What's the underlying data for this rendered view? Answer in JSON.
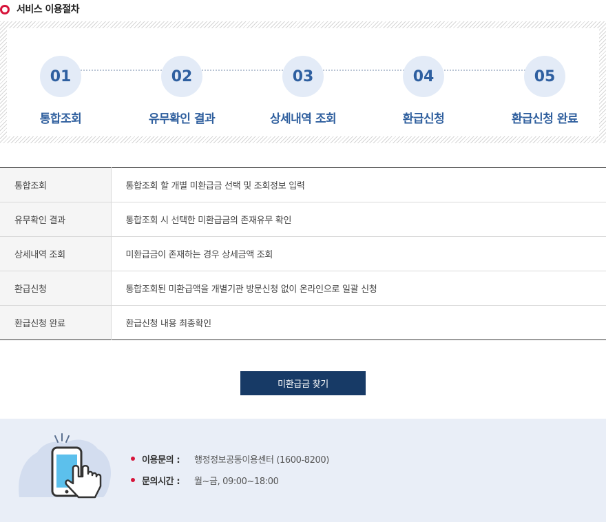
{
  "section_title": "서비스 이용절차",
  "steps": [
    {
      "num": "01",
      "label": "통합조회"
    },
    {
      "num": "02",
      "label": "유무확인 결과"
    },
    {
      "num": "03",
      "label": "상세내역 조회"
    },
    {
      "num": "04",
      "label": "환급신청"
    },
    {
      "num": "05",
      "label": "환급신청 완료"
    }
  ],
  "table": [
    {
      "name": "통합조회",
      "desc": "통합조회 할 개별 미환급금 선택 및 조회정보 입력"
    },
    {
      "name": "유무확인 결과",
      "desc": "통합조회 시 선택한 미환급금의 존재유무 확인"
    },
    {
      "name": "상세내역 조회",
      "desc": "미환급금이 존재하는 경우 상세금액 조회"
    },
    {
      "name": "환급신청",
      "desc": "통합조회된 미환급액을 개별기관 방문신청 없이 온라인으로 일괄 신청"
    },
    {
      "name": "환급신청 완료",
      "desc": "환급신청 내용 최종확인"
    }
  ],
  "find_button": "미환급금 찾기",
  "contact": {
    "inquiry_label": "이용문의 :",
    "inquiry_value": "행정정보공동이용센터 (1600-8200)",
    "hours_label": "문의시간 :",
    "hours_value": "월~금, 09:00~18:00"
  },
  "colors": {
    "accent_red": "#d7143a",
    "navy": "#173a66",
    "step_blue": "#2f5f9e"
  }
}
